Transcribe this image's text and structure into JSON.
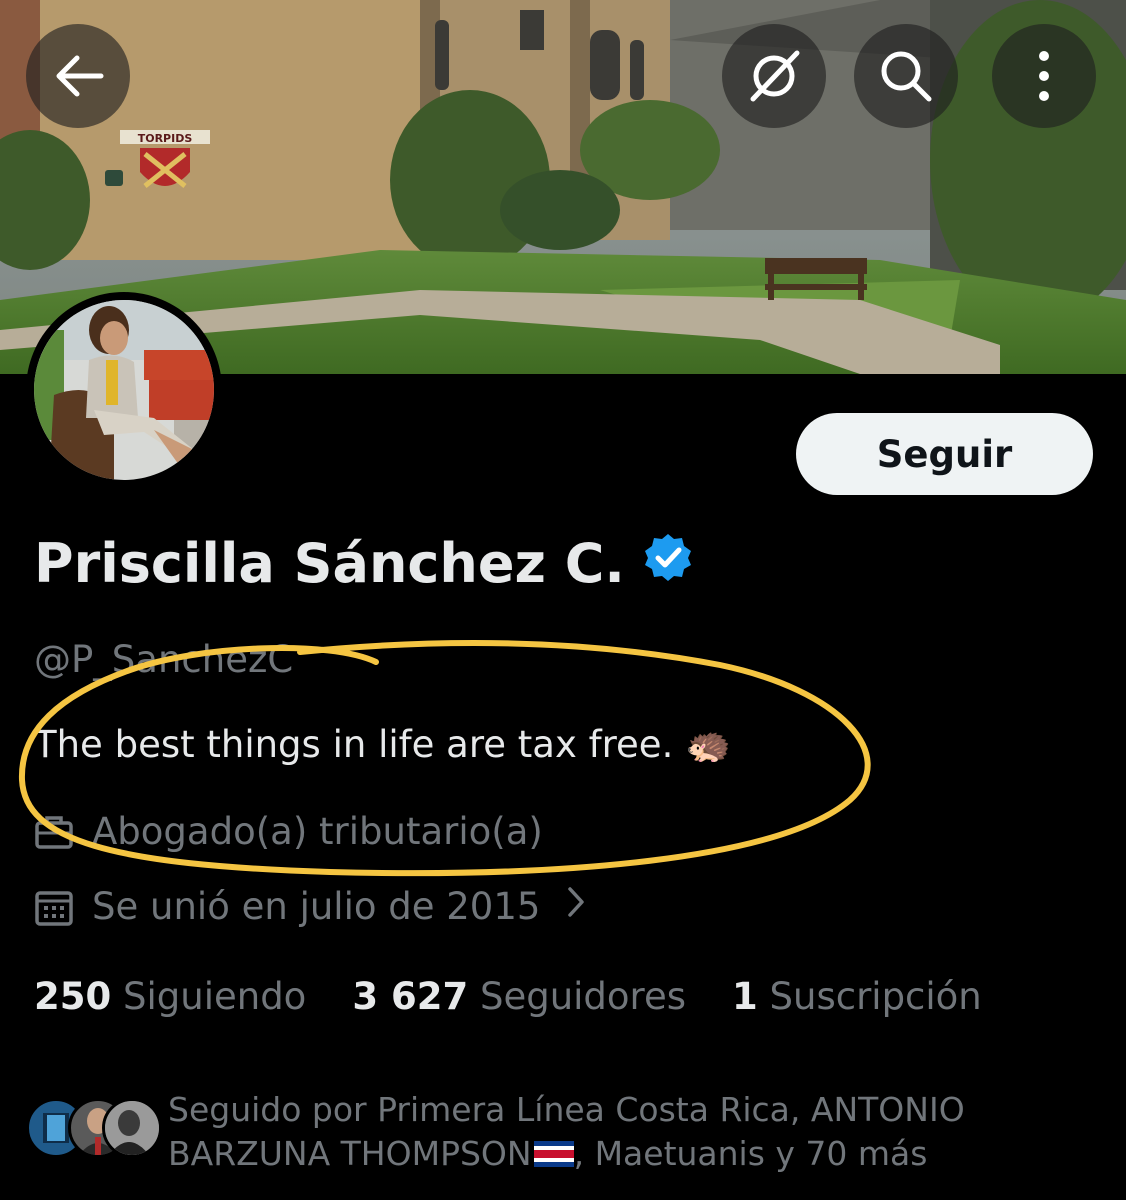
{
  "header": {
    "back_icon": "arrow-left-icon",
    "grok_icon": "grok-icon",
    "search_icon": "search-icon",
    "more_icon": "more-vertical-icon",
    "banner_sign_text": "TORPIDS"
  },
  "profile": {
    "name": "Priscilla Sánchez C.",
    "handle": "@P_SanchezC",
    "bio": "The best things in life are tax free. 🦔",
    "profession": "Abogado(a) tributario(a)",
    "joined": "Se unió en julio de 2015",
    "verified_color": "#1d9bf0"
  },
  "actions": {
    "follow_label": "Seguir"
  },
  "stats": [
    {
      "value": "250",
      "label": "Siguiendo"
    },
    {
      "value": "3 627",
      "label": "Seguidores"
    },
    {
      "value": "1",
      "label": "Suscripción"
    }
  ],
  "followed_by": {
    "line1": "Seguido por Primera Línea Costa Rica, ANTONIO",
    "line2a": "BARZUNA THOMPSON",
    "line2b": ", Maetuanis y 70 más"
  },
  "colors": {
    "background": "#000000",
    "primary_text": "#e7e9ea",
    "secondary_text": "#71767b",
    "annotation": "#f5c542"
  }
}
